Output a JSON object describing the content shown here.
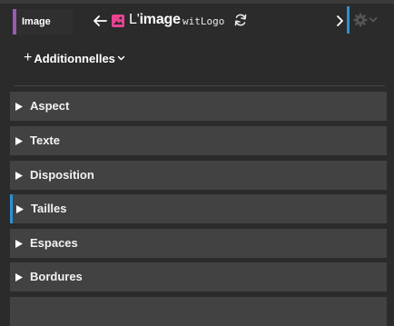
{
  "header": {
    "badge": "Image",
    "title_prefix": "L'",
    "title_main": "image",
    "block_id": "witLogo"
  },
  "actions": {
    "add_label": "Additionnelles"
  },
  "sections": [
    {
      "label": "Aspect"
    },
    {
      "label": "Texte"
    },
    {
      "label": "Disposition"
    },
    {
      "label": "Tailles"
    },
    {
      "label": "Espaces"
    },
    {
      "label": "Bordures"
    }
  ],
  "colors": {
    "badge_accent": "#9b59b6",
    "active_accent": "#2d8fd5",
    "image_icon": "#e84393"
  },
  "icons": [
    "back-arrow-icon",
    "image-icon",
    "refresh-icon",
    "chevron-right-icon",
    "gear-icon",
    "chevron-down-icon",
    "plus-icon",
    "triangle-right-icon"
  ]
}
